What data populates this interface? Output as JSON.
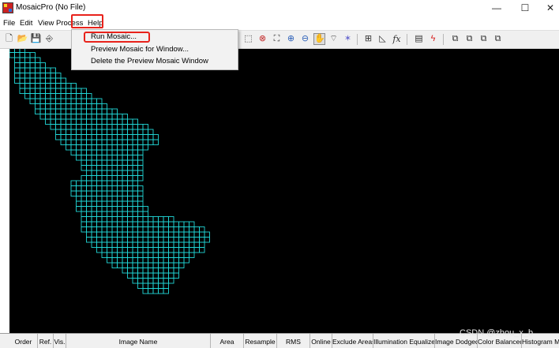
{
  "window": {
    "title": "MosaicPro (No File)",
    "minimize_glyph": "—",
    "maximize_glyph": "☐",
    "close_glyph": "✕"
  },
  "menubar": {
    "items": [
      "File",
      "Edit",
      "View",
      "Process",
      "Help"
    ],
    "open_menu": "Process"
  },
  "toolbar": {
    "icons": [
      "new-icon",
      "open-icon",
      "save-icon",
      "import-icon",
      "select-box-icon",
      "delete-icon",
      "zoom-fit-icon",
      "zoom-in-icon",
      "zoom-out-icon",
      "pan-icon",
      "polygon-icon",
      "clear-icon",
      "image-properties-icon",
      "histogram-icon",
      "function-icon",
      "output-options-icon",
      "run-icon",
      "layer-bring-front-icon",
      "layer-send-back-icon",
      "layer-up-icon",
      "layer-down-icon"
    ],
    "function_glyph": "fx"
  },
  "process_menu": {
    "items": [
      "Run Mosaic...",
      "Preview Mosaic for Window...",
      "Delete the Preview Mosaic Window"
    ],
    "highlighted": "Run Mosaic..."
  },
  "canvas": {
    "background": "#000000",
    "grid_color": "#22d6d6"
  },
  "columns": [
    "Order",
    "Ref.",
    "Vis.",
    "Image Name",
    "Area",
    "Resample",
    "RMS",
    "Online",
    "Exclude Areas",
    "Illumination Equalized",
    "Image Dodged",
    "Color Balanced",
    "Histogram M"
  ],
  "watermark": "CSDN @zhou_x_b"
}
